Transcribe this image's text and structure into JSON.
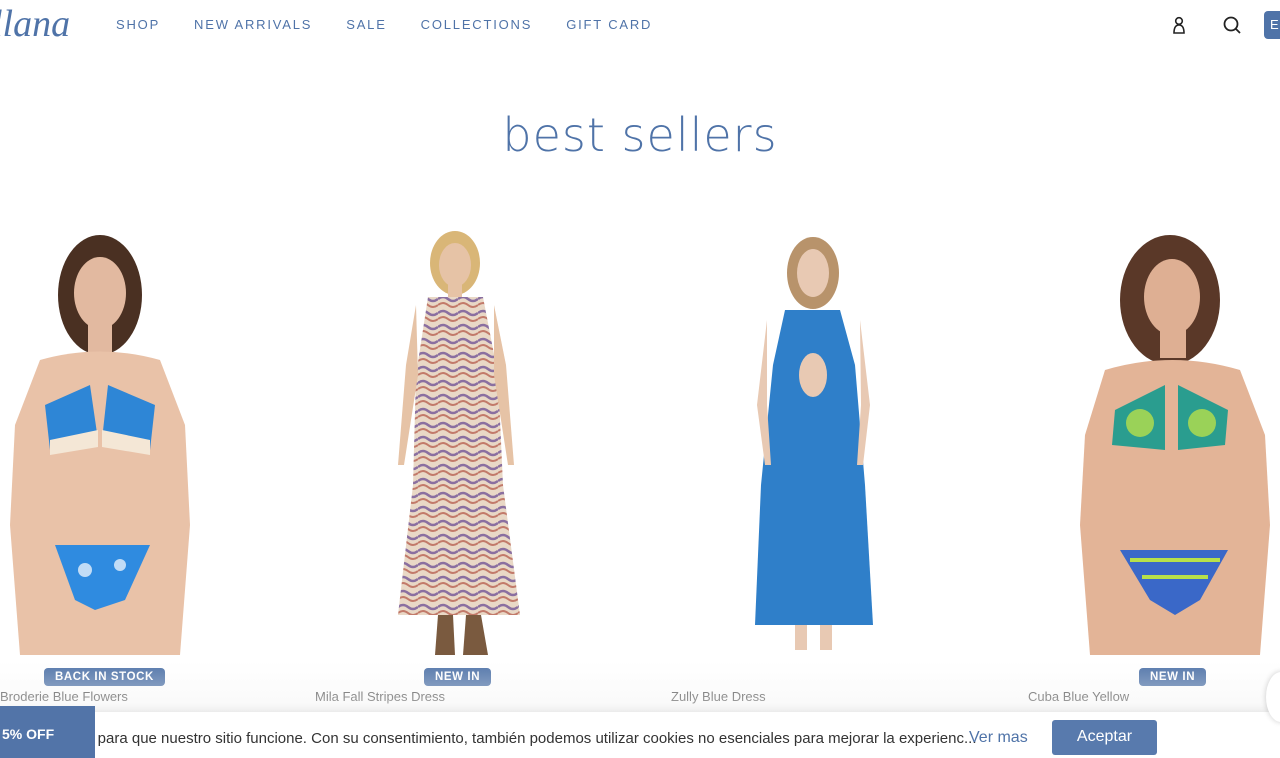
{
  "header": {
    "logo_text": "llana",
    "nav": [
      "SHOP",
      "NEW ARRIVALS",
      "SALE",
      "COLLECTIONS",
      "GIFT CARD"
    ],
    "icons": [
      "account-icon",
      "search-icon"
    ],
    "lang_label": "E"
  },
  "section": {
    "title": "best sellers"
  },
  "products": [
    {
      "badge": "BACK IN STOCK",
      "name": "Broderie Blue Flowers"
    },
    {
      "badge": "NEW IN",
      "name": "Mila Fall Stripes Dress"
    },
    {
      "badge": "",
      "name": "Zully Blue Dress"
    },
    {
      "badge": "NEW IN",
      "name": "Cuba Blue Yellow"
    }
  ],
  "cookie": {
    "text": "s para que nuestro sitio funcione. Con su consentimiento, también podemos utilizar cookies no esenciales para mejorar la experienc...",
    "link": "Ver mas",
    "accept": "Aceptar"
  },
  "promo": {
    "label": "5% OFF"
  },
  "colors": {
    "brand": "#4f73a8",
    "blue_dress": "#2f7fc9"
  }
}
